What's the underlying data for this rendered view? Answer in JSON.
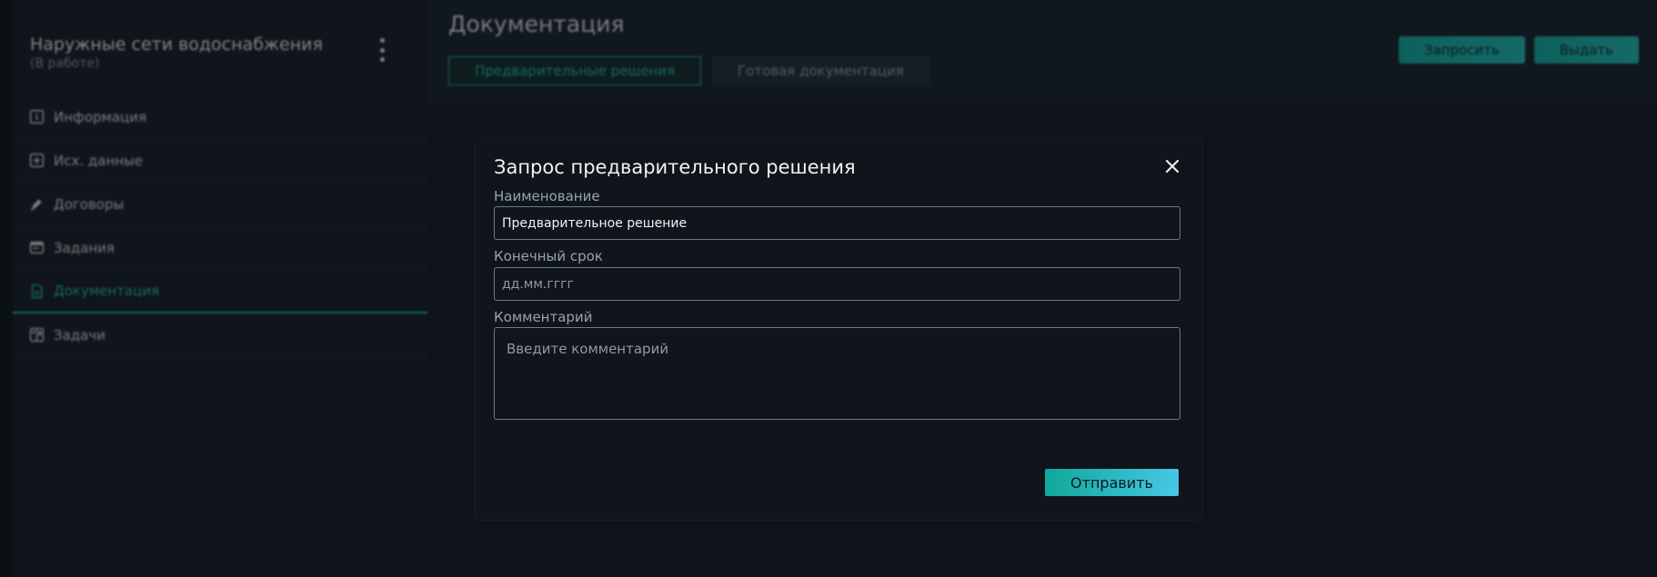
{
  "project": {
    "title": "Наружные сети водоснабжения",
    "status": "(В работе)"
  },
  "sidebar": {
    "items": [
      {
        "label": "Информация",
        "icon": "info-icon"
      },
      {
        "label": "Исх. данные",
        "icon": "plus-box-icon"
      },
      {
        "label": "Договоры",
        "icon": "pen-icon"
      },
      {
        "label": "Задания",
        "icon": "tasks-icon"
      },
      {
        "label": "Документация",
        "icon": "document-icon",
        "active": true
      },
      {
        "label": "Задачи",
        "icon": "board-icon"
      }
    ]
  },
  "main": {
    "title": "Документация",
    "tabs": [
      {
        "label": "Предварительные решения",
        "active": true
      },
      {
        "label": "Готовая документация",
        "active": false
      }
    ],
    "actions": {
      "request_label": "Запросить",
      "issue_label": "Выдать"
    }
  },
  "modal": {
    "title": "Запрос предварительного решения",
    "name_label": "Наименование",
    "name_value": "Предварительное решение",
    "deadline_label": "Конечный срок",
    "deadline_placeholder": "дд.мм.гггг",
    "comment_label": "Комментарий",
    "comment_placeholder": "Введите комментарий",
    "submit_label": "Отправить"
  },
  "colors": {
    "accent": "#1eb8a6",
    "accent_gradient_end": "#47c7e6",
    "background": "#121a20",
    "modal_bg": "#0f151b"
  }
}
